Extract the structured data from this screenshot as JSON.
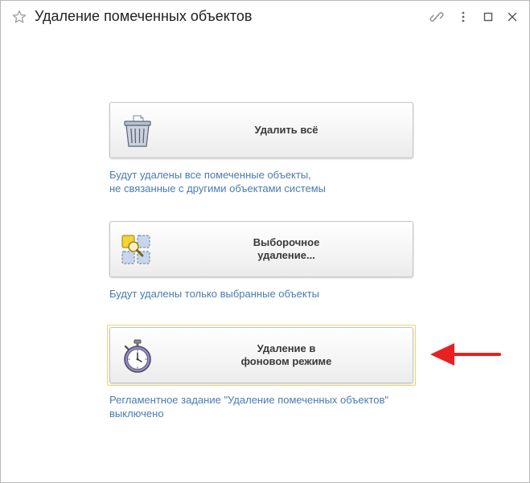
{
  "window": {
    "title": "Удаление помеченных объектов"
  },
  "titlebar_icons": [
    "star-icon",
    "link-icon",
    "more-vertical-icon",
    "maximize-icon",
    "close-icon"
  ],
  "actions": [
    {
      "label": "Удалить всё",
      "icon": "trash-bin-icon",
      "description": "Будут удалены все помеченные объекты,\nне связанные с другими объектами системы"
    },
    {
      "label": "Выборочное\nудаление...",
      "icon": "selective-delete-icon",
      "description": "Будут удалены только выбранные объекты"
    },
    {
      "label": "Удаление в\nфоновом режиме",
      "icon": "stopwatch-icon",
      "description": "Регламентное задание \"Удаление помеченных объектов\"\nвыключено"
    }
  ],
  "colors": {
    "link_text": "#4a7bb0",
    "focus_border": "#e9d66f",
    "annotation_arrow": "#e8201f"
  }
}
